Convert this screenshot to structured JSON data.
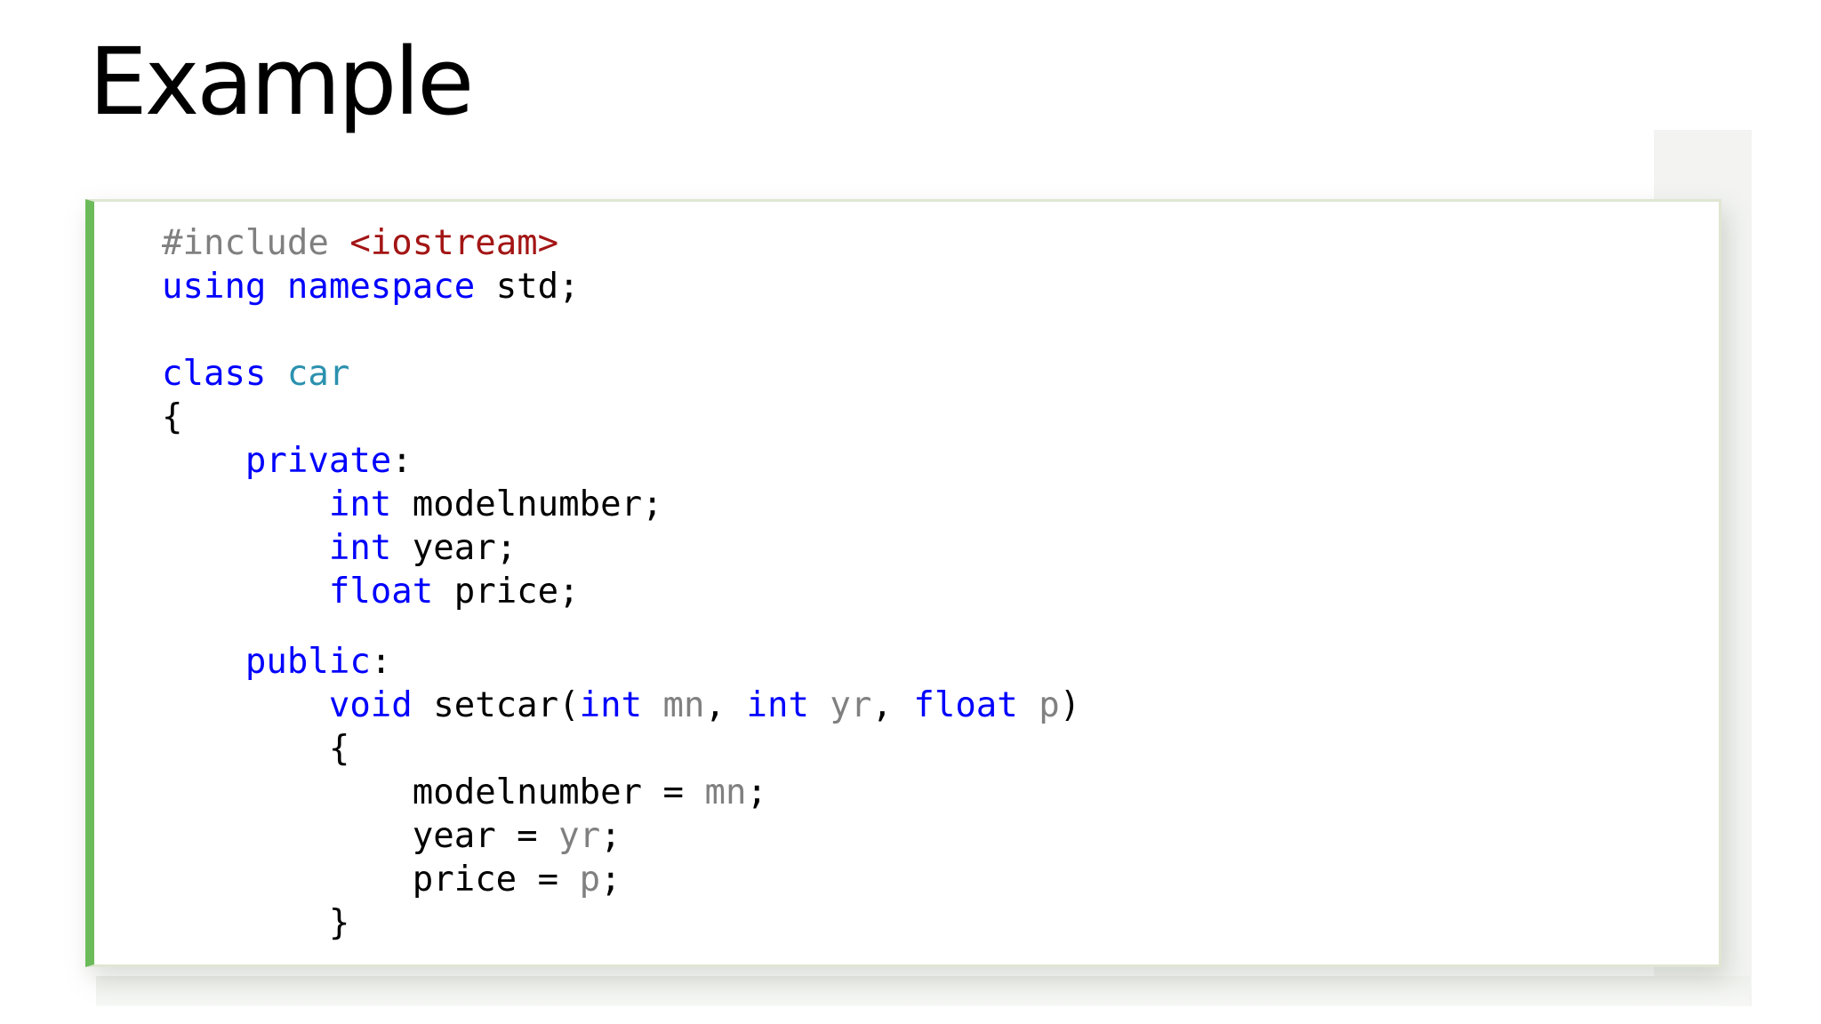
{
  "slide": {
    "title": "Example"
  },
  "code": {
    "lines": [
      [
        [
          "pre",
          "#include "
        ],
        [
          "inc",
          "<iostream>"
        ]
      ],
      [
        [
          "kw",
          "using"
        ],
        [
          "txt",
          " "
        ],
        [
          "kw",
          "namespace"
        ],
        [
          "txt",
          " std;"
        ]
      ],
      [],
      [
        [
          "kw",
          "class"
        ],
        [
          "txt",
          " "
        ],
        [
          "type",
          "car"
        ]
      ],
      [
        [
          "txt",
          "{"
        ]
      ],
      [
        [
          "txt",
          "    "
        ],
        [
          "kw",
          "private"
        ],
        [
          "txt",
          ":"
        ]
      ],
      [
        [
          "txt",
          "        "
        ],
        [
          "kw",
          "int"
        ],
        [
          "txt",
          " modelnumber;"
        ]
      ],
      [
        [
          "txt",
          "        "
        ],
        [
          "kw",
          "int"
        ],
        [
          "txt",
          " year;"
        ]
      ],
      [
        [
          "txt",
          "        "
        ],
        [
          "kw",
          "float"
        ],
        [
          "txt",
          " price;"
        ]
      ],
      null,
      [
        [
          "txt",
          "    "
        ],
        [
          "kw",
          "public"
        ],
        [
          "txt",
          ":"
        ]
      ],
      [
        [
          "txt",
          "        "
        ],
        [
          "kw",
          "void"
        ],
        [
          "txt",
          " setcar("
        ],
        [
          "kw",
          "int"
        ],
        [
          "txt",
          " "
        ],
        [
          "par",
          "mn"
        ],
        [
          "txt",
          ", "
        ],
        [
          "kw",
          "int"
        ],
        [
          "txt",
          " "
        ],
        [
          "par",
          "yr"
        ],
        [
          "txt",
          ", "
        ],
        [
          "kw",
          "float"
        ],
        [
          "txt",
          " "
        ],
        [
          "par",
          "p"
        ],
        [
          "txt",
          ")"
        ]
      ],
      [
        [
          "txt",
          "        {"
        ]
      ],
      [
        [
          "txt",
          "            modelnumber = "
        ],
        [
          "par",
          "mn"
        ],
        [
          "txt",
          ";"
        ]
      ],
      [
        [
          "txt",
          "            year = "
        ],
        [
          "par",
          "yr"
        ],
        [
          "txt",
          ";"
        ]
      ],
      [
        [
          "txt",
          "            price = "
        ],
        [
          "par",
          "p"
        ],
        [
          "txt",
          ";"
        ]
      ],
      [
        [
          "txt",
          "        }"
        ]
      ]
    ]
  },
  "colors": {
    "keyword": "#0000ff",
    "class_name": "#2b91af",
    "include_path": "#a31515",
    "preprocessor": "#808080",
    "parameter": "#808080",
    "accent_bar": "#6cbb5a"
  }
}
